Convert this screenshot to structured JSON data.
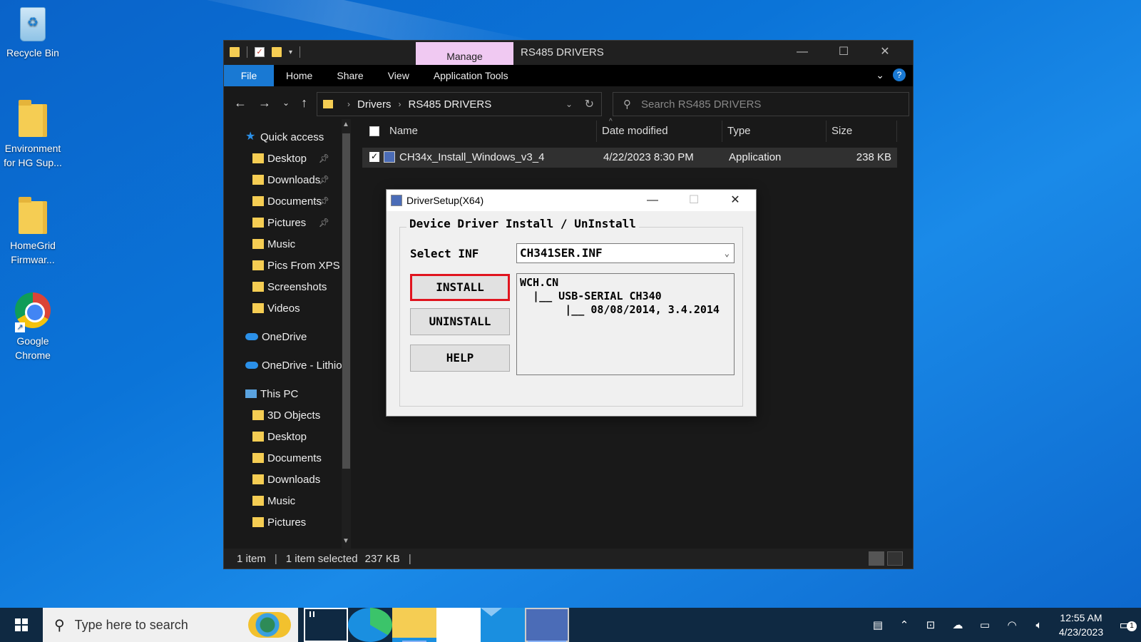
{
  "desktop": {
    "icons": [
      {
        "label": "Recycle Bin",
        "icon": "recycle-bin-icon"
      },
      {
        "label": "Environment for HG Sup...",
        "icon": "folder-icon"
      },
      {
        "label": "HomeGrid Firmwar...",
        "icon": "folder-icon"
      },
      {
        "label": "Google Chrome",
        "icon": "chrome-icon"
      }
    ]
  },
  "explorer": {
    "manage_tab": "Manage",
    "title": "RS485 DRIVERS",
    "ribbon": {
      "file": "File",
      "tabs": [
        "Home",
        "Share",
        "View",
        "Application Tools"
      ]
    },
    "address": {
      "crumbs": [
        "Drivers",
        "RS485 DRIVERS"
      ]
    },
    "search": {
      "placeholder": "Search RS485 DRIVERS"
    },
    "sidebar": {
      "items": [
        {
          "label": "Quick access",
          "icon": "star-icon",
          "pinned": false
        },
        {
          "label": "Desktop",
          "icon": "folder-icon",
          "pinned": true
        },
        {
          "label": "Downloads",
          "icon": "folder-icon",
          "pinned": true
        },
        {
          "label": "Documents",
          "icon": "folder-icon",
          "pinned": true
        },
        {
          "label": "Pictures",
          "icon": "folder-icon",
          "pinned": true
        },
        {
          "label": "Music",
          "icon": "folder-icon",
          "pinned": false
        },
        {
          "label": "Pics From XPS",
          "icon": "folder-icon",
          "pinned": false
        },
        {
          "label": "Screenshots",
          "icon": "folder-icon",
          "pinned": false
        },
        {
          "label": "Videos",
          "icon": "folder-icon",
          "pinned": false
        },
        {
          "label": "OneDrive",
          "icon": "cloud-icon",
          "pinned": false
        },
        {
          "label": "OneDrive - Lithion",
          "icon": "cloud-icon",
          "pinned": false
        },
        {
          "label": "This PC",
          "icon": "pc-icon",
          "pinned": false
        },
        {
          "label": "3D Objects",
          "icon": "folder-icon",
          "pinned": false
        },
        {
          "label": "Desktop",
          "icon": "folder-icon",
          "pinned": false
        },
        {
          "label": "Documents",
          "icon": "folder-icon",
          "pinned": false
        },
        {
          "label": "Downloads",
          "icon": "folder-icon",
          "pinned": false
        },
        {
          "label": "Music",
          "icon": "folder-icon",
          "pinned": false
        },
        {
          "label": "Pictures",
          "icon": "folder-icon",
          "pinned": false
        }
      ]
    },
    "columns": {
      "name": "Name",
      "date": "Date modified",
      "type": "Type",
      "size": "Size"
    },
    "files": [
      {
        "name": "CH34x_Install_Windows_v3_4",
        "date": "4/22/2023 8:30 PM",
        "type": "Application",
        "size": "238 KB"
      }
    ],
    "status": {
      "count": "1 item",
      "selected": "1 item selected",
      "size": "237 KB"
    }
  },
  "dialog": {
    "title": "DriverSetup(X64)",
    "group_label": "Device Driver Install / UnInstall",
    "select_label": "Select INF",
    "select_value": "CH341SER.INF",
    "buttons": {
      "install": "INSTALL",
      "uninstall": "UNINSTALL",
      "help": "HELP"
    },
    "info_lines": [
      "WCH.CN",
      "  |__ USB-SERIAL CH340",
      "       |__ 08/08/2014, 3.4.2014"
    ]
  },
  "taskbar": {
    "search_placeholder": "Type here to search",
    "time": "12:55 AM",
    "date": "4/23/2023",
    "notifications": "1"
  },
  "colors": {
    "accent": "#1979d3",
    "manage_tab": "#f0c9f2",
    "highlight": "#e0141e"
  }
}
